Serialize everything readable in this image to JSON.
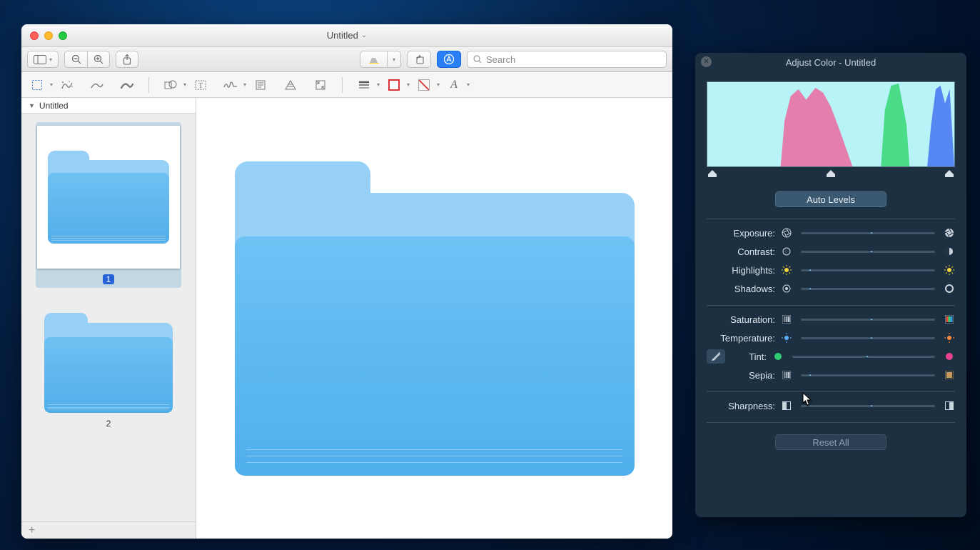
{
  "preview": {
    "title": "Untitled",
    "search_placeholder": "Search",
    "sidebar": {
      "header": "Untitled",
      "pages": [
        {
          "num": "1",
          "selected": true
        },
        {
          "num": "2",
          "selected": false
        }
      ]
    }
  },
  "adjust": {
    "title": "Adjust Color - Untitled",
    "auto_levels": "Auto Levels",
    "reset_all": "Reset All",
    "sliders": {
      "exposure": {
        "label": "Exposure:",
        "pos": 50
      },
      "contrast": {
        "label": "Contrast:",
        "pos": 50
      },
      "highlights": {
        "label": "Highlights:",
        "pos": 4
      },
      "shadows": {
        "label": "Shadows:",
        "pos": 4
      },
      "saturation": {
        "label": "Saturation:",
        "pos": 50
      },
      "temperature": {
        "label": "Temperature:",
        "pos": 50
      },
      "tint": {
        "label": "Tint:",
        "pos": 50
      },
      "sepia": {
        "label": "Sepia:",
        "pos": 4
      },
      "sharpness": {
        "label": "Sharpness:",
        "pos": 50
      }
    },
    "icons": {
      "exposure_left": "aperture",
      "exposure_right": "aperture-inv",
      "contrast_left": "circle-solid",
      "contrast_right": "circle-half",
      "highlights_left": "sun-yellow",
      "highlights_right": "sun-yellow",
      "shadows_left": "target",
      "shadows_right": "ring",
      "saturation_left": "bars-grey",
      "saturation_right": "bars-color",
      "temperature_left": "sun-blue",
      "temperature_right": "sun-orange",
      "tint_left": "dot-green",
      "tint_right": "dot-magenta",
      "sepia_left": "bars-grey",
      "sepia_right": "bars-sepia",
      "sharpness_left": "square-left",
      "sharpness_right": "square-right"
    }
  },
  "colors": {
    "folder_light": "#96d0f6",
    "folder_dark": "#52aee9",
    "panel_bg": "#1d3042"
  }
}
